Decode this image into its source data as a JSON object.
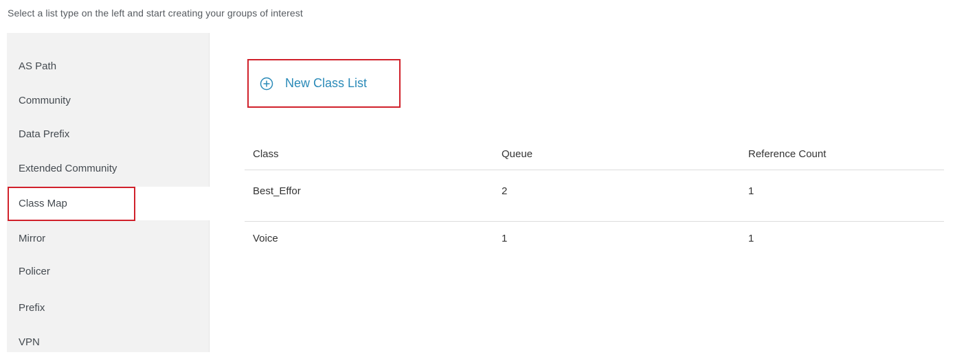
{
  "instruction": "Select a list type on the left and start creating your groups of interest",
  "sidebar": {
    "items": [
      {
        "label": "AS Path"
      },
      {
        "label": "Community"
      },
      {
        "label": "Data Prefix"
      },
      {
        "label": "Extended Community"
      },
      {
        "label": "Class Map",
        "selected": true
      },
      {
        "label": "Mirror"
      },
      {
        "label": "Policer"
      },
      {
        "label": "Prefix"
      },
      {
        "label": "VPN"
      }
    ]
  },
  "main": {
    "new_button": {
      "label": "New Class List",
      "icon": "plus-circle-icon",
      "color": "#2a8ab8"
    },
    "table": {
      "columns": [
        "Class",
        "Queue",
        "Reference Count"
      ],
      "rows": [
        [
          "Best_Effor",
          "2",
          "1"
        ],
        [
          "Voice",
          "1",
          "1"
        ]
      ]
    }
  },
  "colors": {
    "highlight_border": "#d0202a",
    "sidebar_bg": "#f2f2f2",
    "accent": "#2a8ab8"
  }
}
